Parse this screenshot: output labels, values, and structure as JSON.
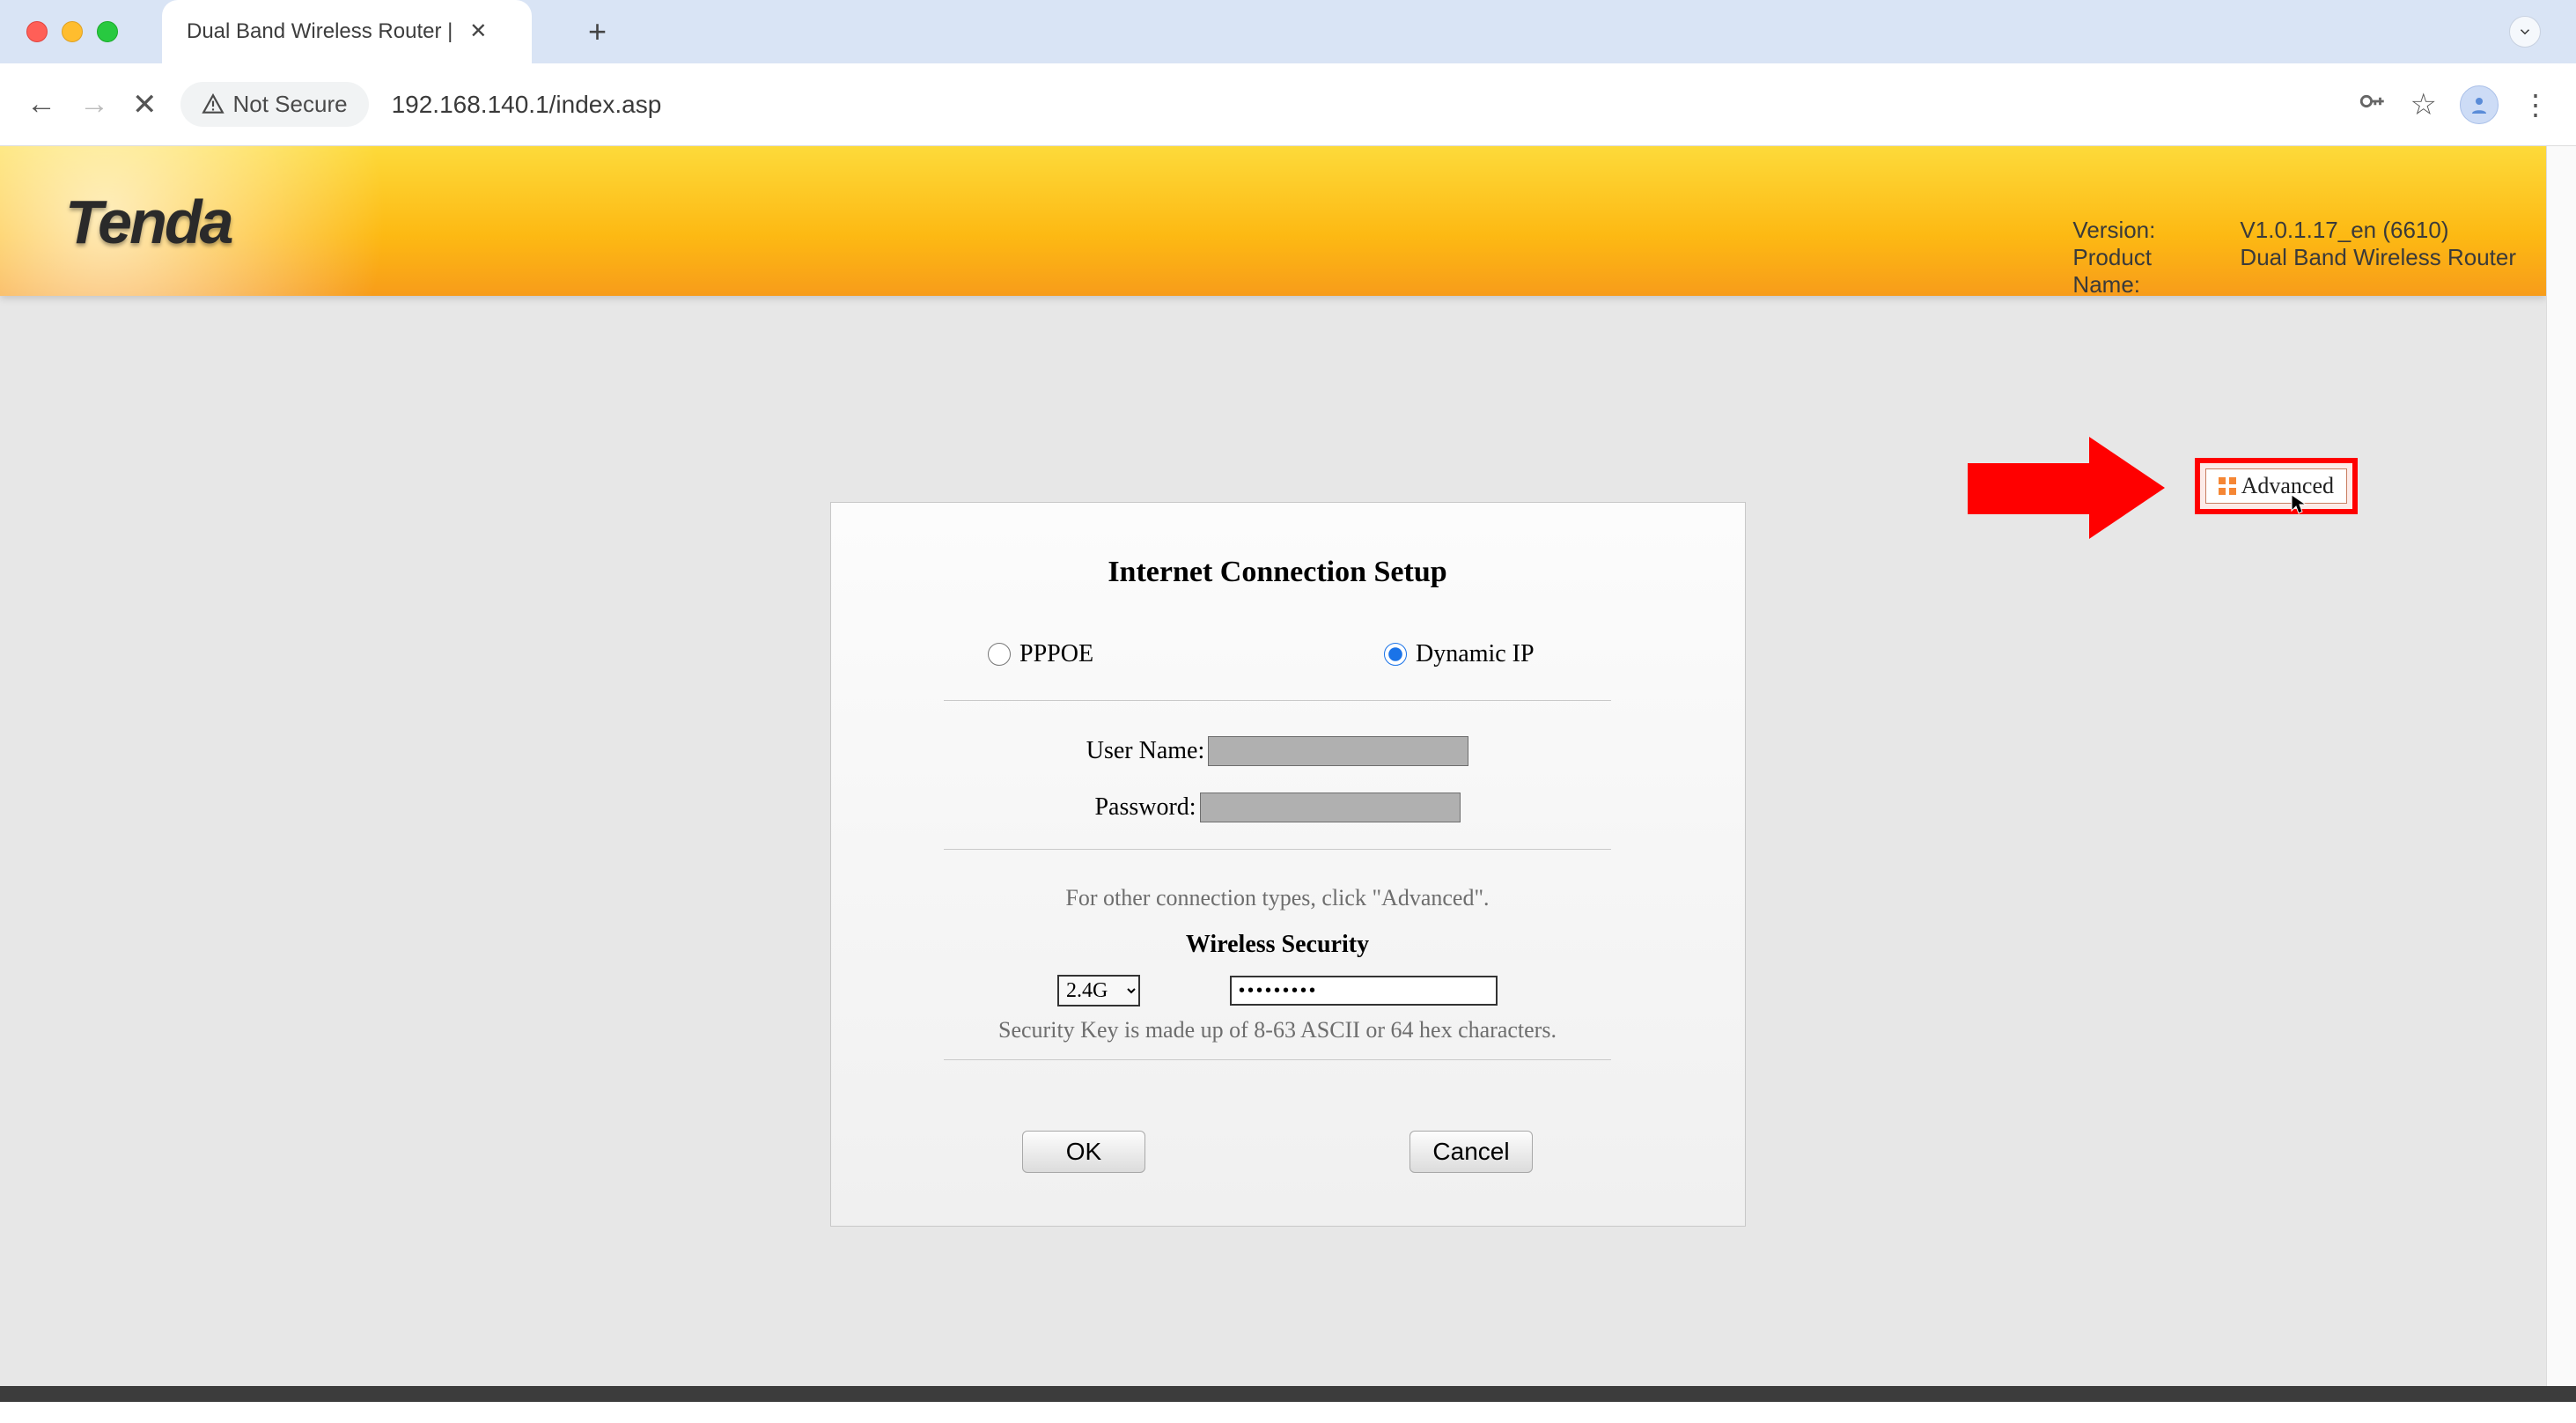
{
  "browser": {
    "tab_title": "Dual Band Wireless Router |",
    "url": "192.168.140.1/index.asp",
    "not_secure": "Not Secure"
  },
  "banner": {
    "logo": "Tenda",
    "version_label": "Version:",
    "version_value": "V1.0.1.17_en (6610)",
    "product_label": "Product Name:",
    "product_value": "Dual Band Wireless Router"
  },
  "advanced": {
    "label": "Advanced"
  },
  "setup": {
    "title": "Internet Connection Setup",
    "pppoe": "PPPOE",
    "dynamic_ip": "Dynamic IP",
    "username_label": "User Name:",
    "username_value": "",
    "password_label": "Password:",
    "password_value": "",
    "hint": "For other connection types, click \"Advanced\".",
    "ws_title": "Wireless Security",
    "band_selected": "2.4G",
    "security_key": "•••••••••",
    "key_hint": "Security Key is made up of 8-63 ASCII or 64 hex characters.",
    "ok": "OK",
    "cancel": "Cancel"
  }
}
